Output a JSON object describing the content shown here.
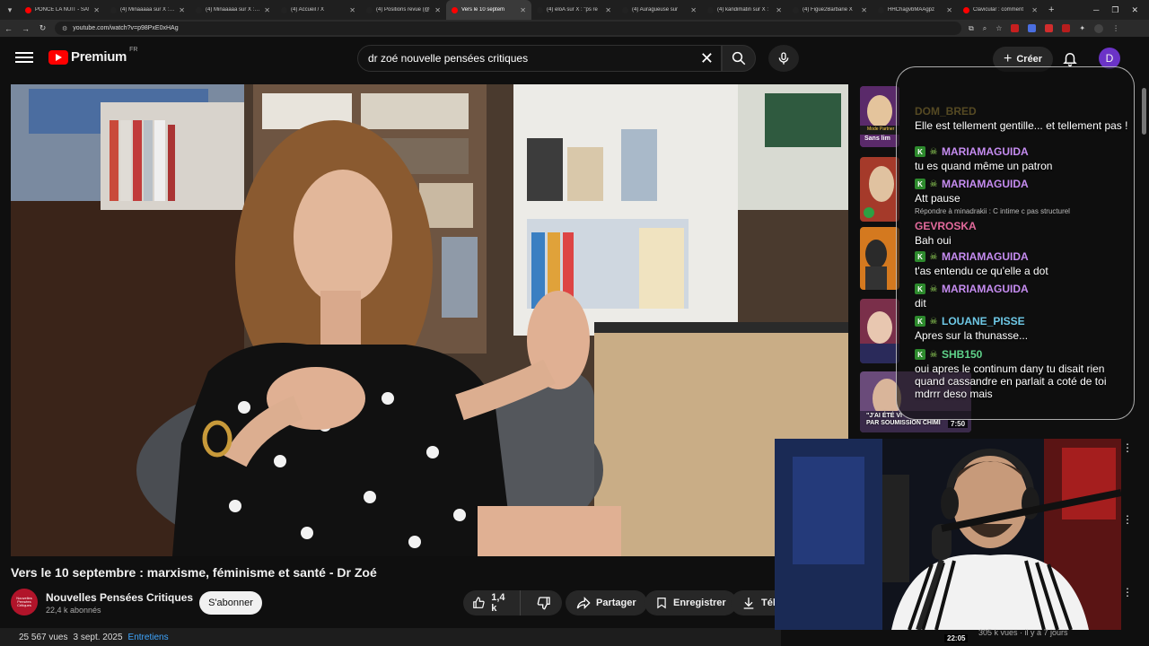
{
  "browser": {
    "tabs": [
      {
        "title": "PONCE LA NUIT - SA!",
        "fav": "#ff0000",
        "active": false
      },
      {
        "title": "(4) Minaaaaa sur X : \"h",
        "fav": "#222",
        "active": false
      },
      {
        "title": "(4) Minaaaaa sur X : \"L",
        "fav": "#222",
        "active": false
      },
      {
        "title": "(4) Accueil / X",
        "fav": "#222",
        "active": false
      },
      {
        "title": "(4) Positions revue (@",
        "fav": "#222",
        "active": false
      },
      {
        "title": "Vers le 10 septem",
        "fav": "#ff0000",
        "active": true
      },
      {
        "title": "(4) eloA sur X : \"ps re",
        "fav": "#222",
        "active": false
      },
      {
        "title": "(4) Auragueuse sur",
        "fav": "#222",
        "active": false
      },
      {
        "title": "(4) kandimatin sur X :",
        "fav": "#222",
        "active": false
      },
      {
        "title": "(4) Figue2Barbarie X",
        "fav": "#222",
        "active": false
      },
      {
        "title": "HHChagvbMAAgpz",
        "fav": "#222",
        "active": false
      },
      {
        "title": "Clavicular : comment",
        "fav": "#ff0000",
        "active": false
      }
    ],
    "url": "youtube.com/watch?v=p98PxE0xHAg"
  },
  "header": {
    "logo_text": "Premium",
    "country_code": "FR",
    "search_query": "dr zoé nouvelle pensées critiques",
    "create_label": "Créer",
    "user_initial": "D"
  },
  "video": {
    "title": "Vers le 10 septembre : marxisme, féminisme et santé - Dr Zoé",
    "channel_name": "Nouvelles Pensées Critiques",
    "channel_avatar_text": "Nouvelles Pensées Critiques",
    "subscribers": "22,4 k abonnés",
    "subscribe_label": "S'abonner",
    "likes": "1,4 k",
    "share_label": "Partager",
    "save_label": "Enregistrer",
    "download_label": "Télé",
    "views": "25 567 vues",
    "date": "3 sept. 2025",
    "tag": "Entretiens"
  },
  "recommendations": {
    "tag_text": "Sans lim",
    "partner_label": "Mode Partner",
    "overlay_text_1": "\"J'AI ÉTÉ VI",
    "overlay_text_2": "PAR SOUMISSION CHIMI",
    "duration": "7:50",
    "side_views": "305 k vues · il y a 7 jours",
    "side_duration": "22:05"
  },
  "chat": {
    "messages": [
      {
        "user": "DOM_BRED",
        "color": "#d9b84a",
        "badges": [],
        "text": "Elle est tellement gentille... et tellement pas !",
        "faded_user": true
      },
      {
        "user": "MARIAMAGUIDA",
        "color": "#c58cf0",
        "badges": [
          "K",
          "skull"
        ],
        "text": "tu es quand même un patron"
      },
      {
        "user": "MARIAMAGUIDA",
        "color": "#c58cf0",
        "badges": [
          "K",
          "skull"
        ],
        "text": "Att pause"
      },
      {
        "user": "GEVROSKA",
        "color": "#e36a9c",
        "badges": [],
        "text": "Bah oui",
        "reply": "Répondre à minadrakii : C intime c pas structurel"
      },
      {
        "user": "MARIAMAGUIDA",
        "color": "#c58cf0",
        "badges": [
          "K",
          "skull"
        ],
        "text": "t'as entendu ce qu'elle a dot"
      },
      {
        "user": "MARIAMAGUIDA",
        "color": "#c58cf0",
        "badges": [
          "K",
          "skull"
        ],
        "text": "dit"
      },
      {
        "user": "LOUANE_PISSE",
        "color": "#6ec8e6",
        "badges": [
          "K",
          "skull"
        ],
        "text": "Apres sur la thunasse..."
      },
      {
        "user": "SHB150",
        "color": "#5fd38a",
        "badges": [
          "K",
          "skull"
        ],
        "text": "oui apres le continum dany tu disait rien quand cassandre en parlait a coté de toi mdrrr deso mais"
      }
    ]
  }
}
